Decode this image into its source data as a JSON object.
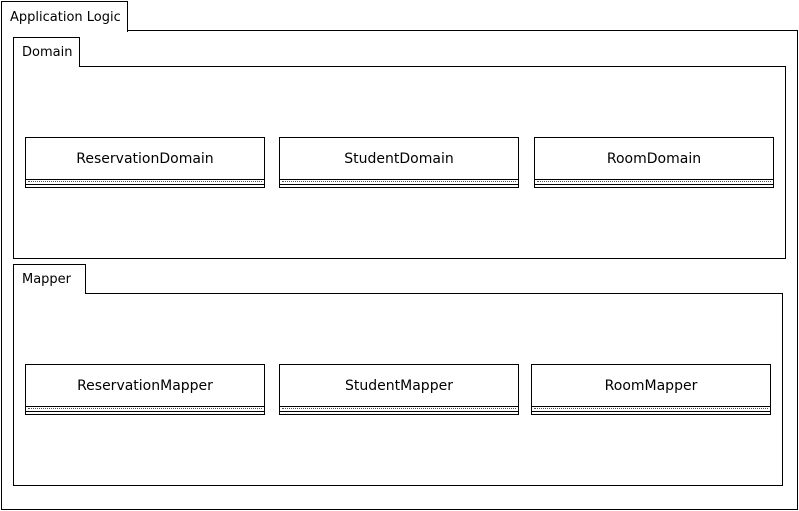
{
  "outer_package": {
    "name": "Application Logic"
  },
  "packages": [
    {
      "name": "Domain",
      "classes": [
        "ReservationDomain",
        "StudentDomain",
        "RoomDomain"
      ]
    },
    {
      "name": "Mapper",
      "classes": [
        "ReservationMapper",
        "StudentMapper",
        "RoomMapper"
      ]
    }
  ]
}
